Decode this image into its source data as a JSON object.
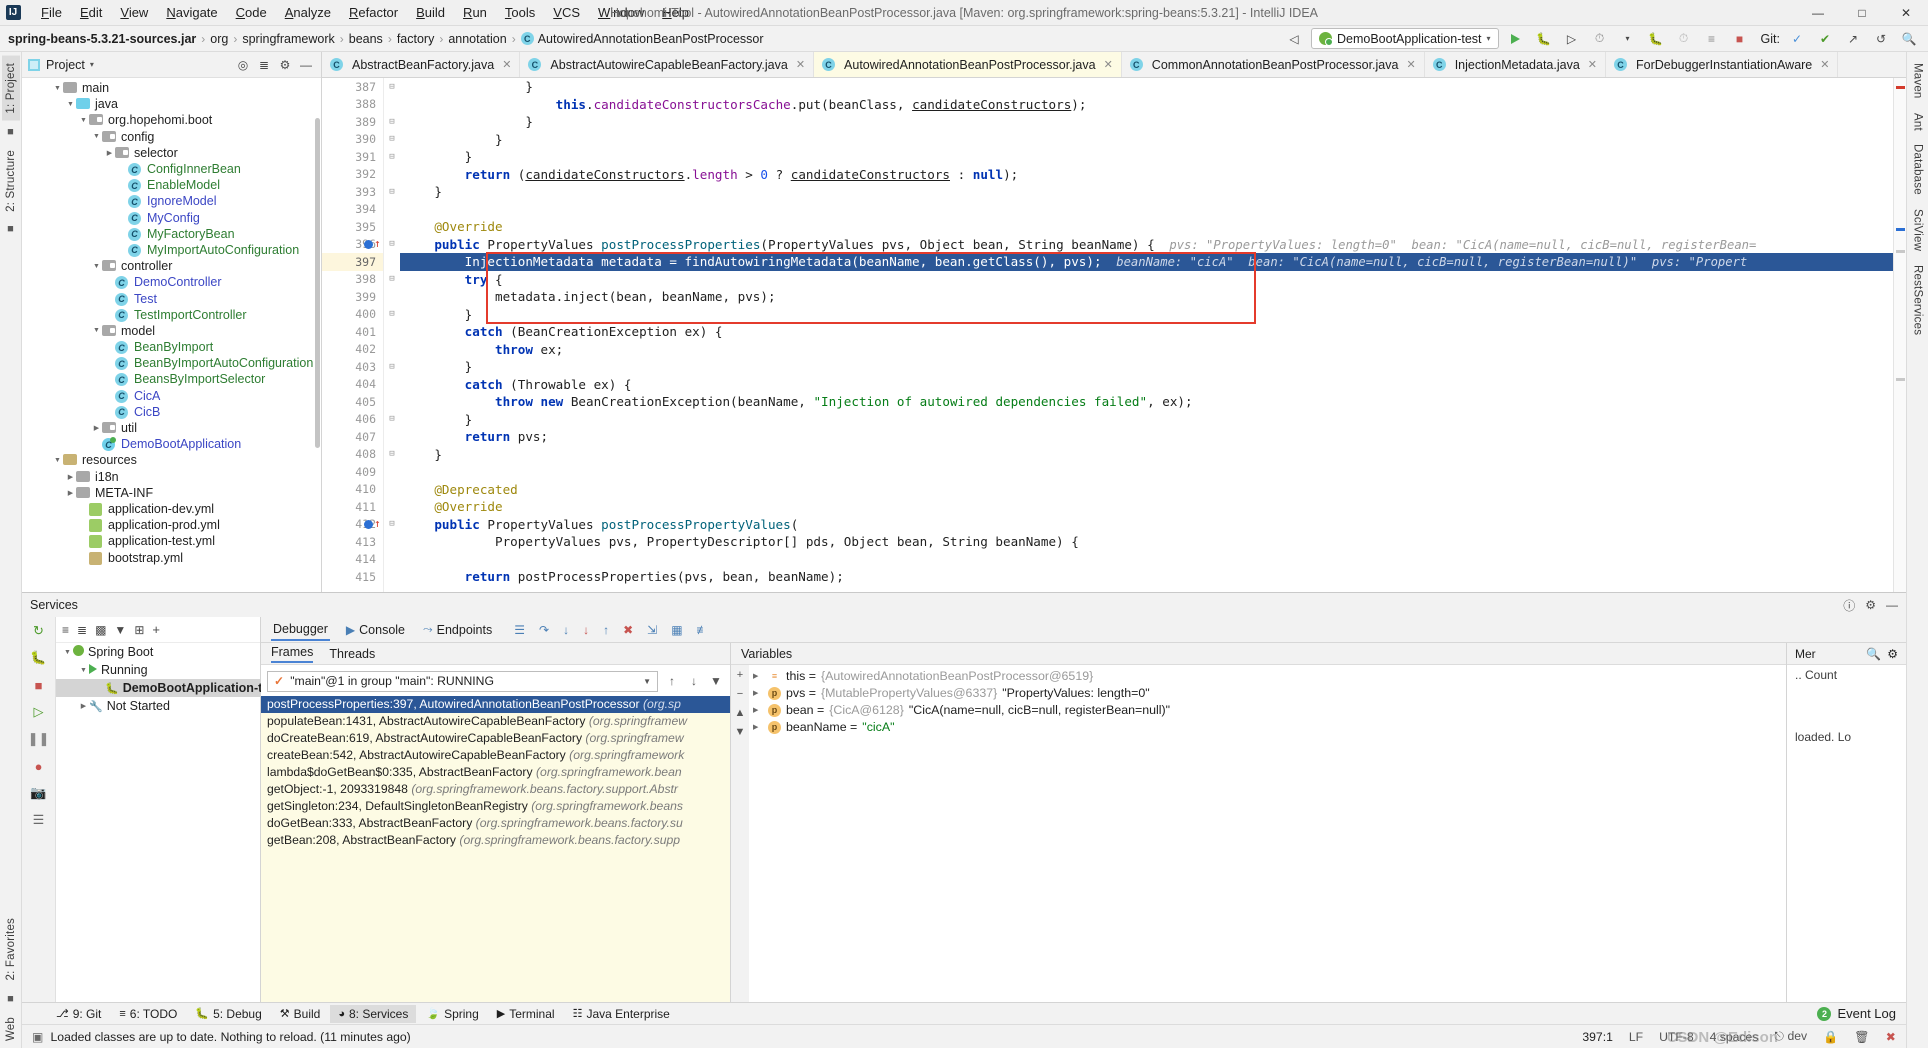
{
  "window": {
    "title": "Hopehomi-Tool - AutowiredAnnotationBeanPostProcessor.java [Maven: org.springframework:spring-beans:5.3.21] - IntelliJ IDEA",
    "minimize": "—",
    "maximize": "□",
    "close": "✕"
  },
  "menu": [
    "File",
    "Edit",
    "View",
    "Navigate",
    "Code",
    "Analyze",
    "Refactor",
    "Build",
    "Run",
    "Tools",
    "VCS",
    "Window",
    "Help"
  ],
  "breadcrumb": {
    "jar": "spring-beans-5.3.21-sources.jar",
    "parts": [
      "org",
      "springframework",
      "beans",
      "factory",
      "annotation"
    ],
    "class": "AutowiredAnnotationBeanPostProcessor",
    "separator": "›"
  },
  "toolbar": {
    "run_config": "DemoBootApplication-test",
    "git_label": "Git:",
    "dropdown_caret": "▾"
  },
  "project_panel": {
    "title": "Project",
    "caret": "▾",
    "tree": [
      {
        "indent": 2,
        "arrow": "▼",
        "icon": "folder",
        "label": "main",
        "color": "dark"
      },
      {
        "indent": 3,
        "arrow": "▼",
        "icon": "folder-blue",
        "label": "java",
        "color": "dark"
      },
      {
        "indent": 4,
        "arrow": "▼",
        "icon": "package",
        "label": "org.hopehomi.boot",
        "color": "dark"
      },
      {
        "indent": 5,
        "arrow": "▼",
        "icon": "package",
        "label": "config",
        "color": "dark"
      },
      {
        "indent": 6,
        "arrow": "▶",
        "icon": "package",
        "label": "selector",
        "color": "dark"
      },
      {
        "indent": 7,
        "arrow": "",
        "icon": "class",
        "label": "ConfigInnerBean",
        "color": "green"
      },
      {
        "indent": 7,
        "arrow": "",
        "icon": "class",
        "label": "EnableModel",
        "color": "green"
      },
      {
        "indent": 7,
        "arrow": "",
        "icon": "class",
        "label": "IgnoreModel",
        "color": "blue"
      },
      {
        "indent": 7,
        "arrow": "",
        "icon": "class",
        "label": "MyConfig",
        "color": "blue"
      },
      {
        "indent": 7,
        "arrow": "",
        "icon": "class",
        "label": "MyFactoryBean",
        "color": "green"
      },
      {
        "indent": 7,
        "arrow": "",
        "icon": "class",
        "label": "MyImportAutoConfiguration",
        "color": "green"
      },
      {
        "indent": 5,
        "arrow": "▼",
        "icon": "package",
        "label": "controller",
        "color": "dark"
      },
      {
        "indent": 6,
        "arrow": "",
        "icon": "class",
        "label": "DemoController",
        "color": "blue"
      },
      {
        "indent": 6,
        "arrow": "",
        "icon": "class",
        "label": "Test",
        "color": "blue"
      },
      {
        "indent": 6,
        "arrow": "",
        "icon": "class",
        "label": "TestImportController",
        "color": "green"
      },
      {
        "indent": 5,
        "arrow": "▼",
        "icon": "package",
        "label": "model",
        "color": "dark"
      },
      {
        "indent": 6,
        "arrow": "",
        "icon": "class",
        "label": "BeanByImport",
        "color": "green"
      },
      {
        "indent": 6,
        "arrow": "",
        "icon": "class",
        "label": "BeanByImportAutoConfiguration",
        "color": "green"
      },
      {
        "indent": 6,
        "arrow": "",
        "icon": "class",
        "label": "BeansByImportSelector",
        "color": "green"
      },
      {
        "indent": 6,
        "arrow": "",
        "icon": "class",
        "label": "CicA",
        "color": "blue"
      },
      {
        "indent": 6,
        "arrow": "",
        "icon": "class",
        "label": "CicB",
        "color": "blue"
      },
      {
        "indent": 5,
        "arrow": "▶",
        "icon": "package",
        "label": "util",
        "color": "dark"
      },
      {
        "indent": 5,
        "arrow": "",
        "icon": "spring-class",
        "label": "DemoBootApplication",
        "color": "blue"
      },
      {
        "indent": 2,
        "arrow": "▼",
        "icon": "folder-res",
        "label": "resources",
        "color": "dark"
      },
      {
        "indent": 3,
        "arrow": "▶",
        "icon": "folder",
        "label": "i18n",
        "color": "dark"
      },
      {
        "indent": 3,
        "arrow": "▶",
        "icon": "folder",
        "label": "META-INF",
        "color": "dark"
      },
      {
        "indent": 4,
        "arrow": "",
        "icon": "yml",
        "label": "application-dev.yml",
        "color": "dark"
      },
      {
        "indent": 4,
        "arrow": "",
        "icon": "yml",
        "label": "application-prod.yml",
        "color": "dark"
      },
      {
        "indent": 4,
        "arrow": "",
        "icon": "yml",
        "label": "application-test.yml",
        "color": "dark"
      },
      {
        "indent": 4,
        "arrow": "",
        "icon": "yml-boot",
        "label": "bootstrap.yml",
        "color": "dark"
      }
    ]
  },
  "editor_tabs": [
    {
      "label": "AbstractBeanFactory.java",
      "active": false
    },
    {
      "label": "AbstractAutowireCapableBeanFactory.java",
      "active": false
    },
    {
      "label": "AutowiredAnnotationBeanPostProcessor.java",
      "active": true
    },
    {
      "label": "CommonAnnotationBeanPostProcessor.java",
      "active": false
    },
    {
      "label": "InjectionMetadata.java",
      "active": false
    },
    {
      "label": "ForDebuggerInstantiationAware",
      "active": false
    }
  ],
  "code": {
    "first_line": 387,
    "current_line": 397,
    "lines": [
      {
        "n": 387,
        "html": "                }"
      },
      {
        "n": 388,
        "html": "                    <span class='kw'>this</span>.<span class='fld'>candidateConstructorsCache</span>.put(beanClass, <span class='und'>candidateConstructors</span>);"
      },
      {
        "n": 389,
        "html": "                }"
      },
      {
        "n": 390,
        "html": "            }"
      },
      {
        "n": 391,
        "html": "        }"
      },
      {
        "n": 392,
        "html": "        <span class='kw'>return</span> (<span class='und'>candidateConstructors</span>.<span class='fld'>length</span> &gt; <span class='num'>0</span> ? <span class='und'>candidateConstructors</span> : <span class='kw'>null</span>);"
      },
      {
        "n": 393,
        "html": "    }"
      },
      {
        "n": 394,
        "html": ""
      },
      {
        "n": 395,
        "html": "    <span class='anno'>@Override</span>"
      },
      {
        "n": 396,
        "html": "    <span class='kw'>public</span> PropertyValues <span class='mth'>postProcessProperties</span>(PropertyValues pvs, Object bean, String beanName) {<span class='hint'>  pvs: \"PropertyValues: length=0\"  bean: \"CicA(name=null, cicB=null, registerBean=</span>"
      },
      {
        "n": 397,
        "html": "        InjectionMetadata metadata = findAutowiringMetadata(beanName, bean.getClass(), pvs);<span class='hint'>  beanName: \"cicA\"  bean: \"CicA(name=null, cicB=null, registerBean=null)\"  pvs: \"Propert</span>",
        "highlight": true
      },
      {
        "n": 398,
        "html": "        <span class='kw'>try</span> {"
      },
      {
        "n": 399,
        "html": "            metadata.inject(bean, beanName, pvs);"
      },
      {
        "n": 400,
        "html": "        }"
      },
      {
        "n": 401,
        "html": "        <span class='kw'>catch</span> (BeanCreationException ex) {"
      },
      {
        "n": 402,
        "html": "            <span class='kw'>throw</span> ex;"
      },
      {
        "n": 403,
        "html": "        }"
      },
      {
        "n": 404,
        "html": "        <span class='kw'>catch</span> (Throwable ex) {"
      },
      {
        "n": 405,
        "html": "            <span class='kw'>throw new</span> BeanCreationException(beanName, <span class='str'>\"Injection of autowired dependencies failed\"</span>, ex);"
      },
      {
        "n": 406,
        "html": "        }"
      },
      {
        "n": 407,
        "html": "        <span class='kw'>return</span> pvs;"
      },
      {
        "n": 408,
        "html": "    }"
      },
      {
        "n": 409,
        "html": ""
      },
      {
        "n": 410,
        "html": "    <span class='anno'>@Deprecated</span>"
      },
      {
        "n": 411,
        "html": "    <span class='anno'>@Override</span>"
      },
      {
        "n": 412,
        "html": "    <span class='kw'>public</span> PropertyValues <span class='mth'>postProcessPropertyValues</span>("
      },
      {
        "n": 413,
        "html": "            PropertyValues pvs, PropertyDescriptor[] pds, Object bean, String beanName) {"
      },
      {
        "n": 414,
        "html": ""
      },
      {
        "n": 415,
        "html": "        <span class='kw'>return</span> postProcessProperties(pvs, bean, beanName);"
      }
    ]
  },
  "services": {
    "title": "Services",
    "tree": [
      {
        "indent": 0,
        "arrow": "▼",
        "icon": "spring",
        "label": "Spring Boot",
        "bold": false
      },
      {
        "indent": 1,
        "arrow": "▼",
        "icon": "run",
        "label": "Running",
        "bold": false
      },
      {
        "indent": 2,
        "arrow": "",
        "icon": "debug",
        "label": "DemoBootApplication-test",
        "bold": true,
        "selected": true
      },
      {
        "indent": 1,
        "arrow": "▶",
        "icon": "wrench",
        "label": "Not Started",
        "bold": false
      }
    ]
  },
  "debugger": {
    "tabs": [
      {
        "label": "Debugger",
        "active": true
      },
      {
        "label": "Console",
        "active": false
      },
      {
        "label": "Endpoints",
        "active": false
      }
    ],
    "frames_tabs": [
      {
        "label": "Frames",
        "active": true
      },
      {
        "label": "Threads",
        "active": false
      }
    ],
    "thread_selector": "\"main\"@1 in group \"main\": RUNNING",
    "frames": [
      {
        "method": "postProcessProperties:397, AutowiredAnnotationBeanPostProcessor",
        "pkg": "(org.sp",
        "selected": true
      },
      {
        "method": "populateBean:1431, AbstractAutowireCapableBeanFactory",
        "pkg": "(org.springframew",
        "selected": false
      },
      {
        "method": "doCreateBean:619, AbstractAutowireCapableBeanFactory",
        "pkg": "(org.springframew",
        "selected": false
      },
      {
        "method": "createBean:542, AbstractAutowireCapableBeanFactory",
        "pkg": "(org.springframework",
        "selected": false
      },
      {
        "method": "lambda$doGetBean$0:335, AbstractBeanFactory",
        "pkg": "(org.springframework.bean",
        "selected": false
      },
      {
        "method": "getObject:-1, 2093319848",
        "pkg": "(org.springframework.beans.factory.support.Abstr",
        "selected": false
      },
      {
        "method": "getSingleton:234, DefaultSingletonBeanRegistry",
        "pkg": "(org.springframework.beans",
        "selected": false
      },
      {
        "method": "doGetBean:333, AbstractBeanFactory",
        "pkg": "(org.springframework.beans.factory.su",
        "selected": false
      },
      {
        "method": "getBean:208, AbstractBeanFactory",
        "pkg": "(org.springframework.beans.factory.supp",
        "selected": false
      }
    ],
    "variables_title": "Variables",
    "variables": [
      {
        "icon": "obj",
        "badge": "≡",
        "name": "this",
        "ref": "{AutowiredAnnotationBeanPostProcessor@6519}",
        "value": ""
      },
      {
        "icon": "p",
        "badge": "p",
        "name": "pvs",
        "ref": "{MutablePropertyValues@6337}",
        "value": "\"PropertyValues: length=0\""
      },
      {
        "icon": "p",
        "badge": "p",
        "name": "bean",
        "ref": "{CicA@6128}",
        "value": "\"CicA(name=null, cicB=null, registerBean=null)\""
      },
      {
        "icon": "p",
        "badge": "p",
        "name": "beanName",
        "ref": "",
        "value": "\"cicA\"",
        "green": true
      }
    ],
    "memory_title": "Mer",
    "memory_count": ".. Count",
    "memory_note": "loaded. Lo"
  },
  "left_rail": [
    "1: Project",
    "2: Structure",
    "2: Favorites",
    "Web"
  ],
  "right_rail": [
    "Maven",
    "Ant",
    "Database",
    "SciView",
    "RestServices"
  ],
  "bottom_tabs": [
    {
      "label": "9: Git",
      "icon": "git",
      "selected": false
    },
    {
      "label": "6: TODO",
      "icon": "todo",
      "selected": false
    },
    {
      "label": "5: Debug",
      "icon": "debug",
      "selected": false
    },
    {
      "label": "Build",
      "icon": "build",
      "selected": false
    },
    {
      "label": "8: Services",
      "icon": "services",
      "selected": true
    },
    {
      "label": "Spring",
      "icon": "spring",
      "selected": false
    },
    {
      "label": "Terminal",
      "icon": "terminal",
      "selected": false
    },
    {
      "label": "Java Enterprise",
      "icon": "javaee",
      "selected": false
    }
  ],
  "event_log": {
    "label": "Event Log",
    "count": "2"
  },
  "status": {
    "message": "Loaded classes are up to date. Nothing to reload. (11 minutes ago)",
    "caret": "397:1",
    "line_sep": "LF",
    "encoding": "UTF-8",
    "indent": "4 spaces",
    "branch": "dev",
    "watermark": "CSDN @Edison"
  }
}
